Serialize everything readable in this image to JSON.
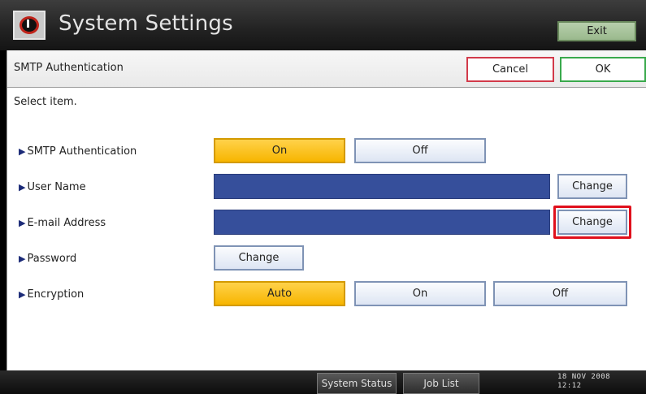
{
  "window": {
    "title": "System Settings",
    "app_icon": "clock-settings-icon",
    "exit_label": "Exit"
  },
  "header": {
    "screen_title": "SMTP Authentication",
    "cancel_label": "Cancel",
    "ok_label": "OK"
  },
  "instruction": "Select item.",
  "rows": {
    "smtp_auth": {
      "label": "SMTP Authentication",
      "options": [
        "On",
        "Off"
      ],
      "selected": "On"
    },
    "user_name": {
      "label": "User Name",
      "value": "",
      "change_label": "Change"
    },
    "email": {
      "label": "E-mail Address",
      "value": "",
      "change_label": "Change"
    },
    "password": {
      "label": "Password",
      "change_label": "Change"
    },
    "encryption": {
      "label": "Encryption",
      "options": [
        "Auto",
        "On",
        "Off"
      ],
      "selected": "Auto"
    }
  },
  "statusbar": {
    "system_status_label": "System Status",
    "job_list_label": "Job List",
    "date": "18 NOV 2008",
    "time": "12:12"
  },
  "colors": {
    "selected": "#f7b500",
    "field": "#364f9b",
    "highlight": "#e0101c",
    "cancel_border": "#d23a4a",
    "ok_border": "#39a94c"
  }
}
